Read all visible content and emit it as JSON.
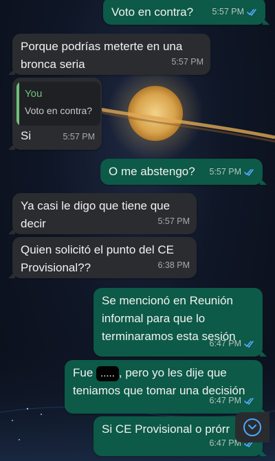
{
  "colors": {
    "incoming_bubble": "#2b2c30",
    "outgoing_bubble": "#0c5a47",
    "read_ticks": "#5aa9ff",
    "quote_accent": "#6fc17a"
  },
  "messages": [
    {
      "text": "Voto en contra?",
      "time": "5:57 PM",
      "status": "read-ticks-icon"
    },
    {
      "text": "Porque podrías meterte en una bronca seria",
      "time": "5:57 PM"
    },
    {
      "quote_author": "You",
      "quote_text": "Voto en contra?",
      "text": "Si",
      "time": "5:57 PM"
    },
    {
      "text": "O me abstengo?",
      "time": "5:57 PM",
      "status": "read-ticks-icon"
    },
    {
      "text": "Ya casi le digo que tiene que decir",
      "time": "5:57 PM"
    },
    {
      "text": "Quien solicitó el punto del CE Provisional??",
      "time": "6:38 PM"
    },
    {
      "text": "Se mencionó en Reunión informal para que lo terminaramos esta sesión",
      "time": "6:47 PM",
      "status": "read-ticks-icon"
    },
    {
      "text_before": "Fue ",
      "redacted": ".....",
      "text_after": ", pero yo les dije que teniamos que tomar una decisión",
      "time": "6:47 PM",
      "status": "read-ticks-icon"
    },
    {
      "text": "Si CE Provisional o prórr",
      "time": "6:47 PM",
      "status": "read-ticks-icon"
    }
  ],
  "scroll_button": {
    "icon": "chevron-down-icon"
  }
}
